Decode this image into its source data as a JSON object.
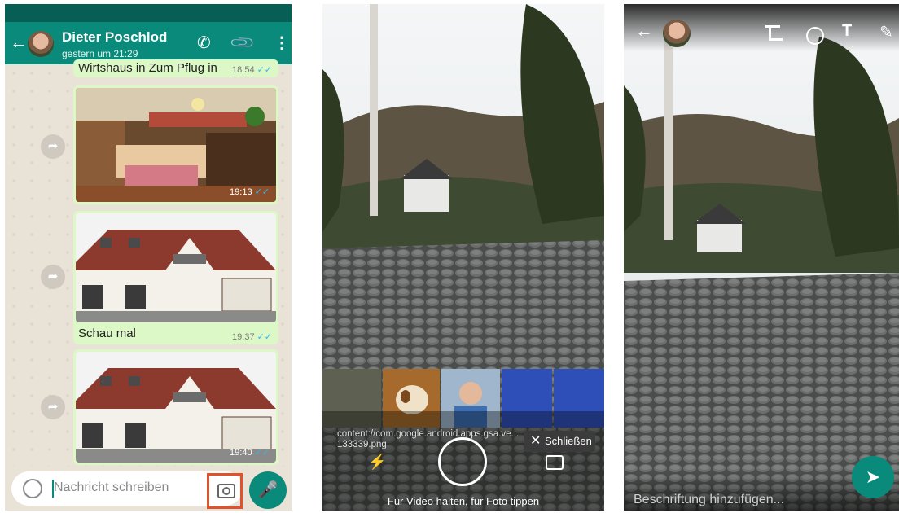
{
  "chat": {
    "contact_name": "Dieter Poschlod",
    "last_seen": "gestern um 21:29",
    "messages": [
      {
        "caption": "Wirtshaus in Zum Pflug in",
        "time": "18:54"
      },
      {
        "time": "19:13"
      },
      {
        "caption": "Schau mal",
        "time": "19:37"
      },
      {
        "time": "19:40"
      }
    ],
    "input_placeholder": "Nachricht schreiben",
    "icons": {
      "back": "arrow-left-icon",
      "call": "phone-icon",
      "attach": "paperclip-icon",
      "menu": "more-vert-icon",
      "emoji": "emoji-icon",
      "camera": "camera-icon",
      "mic": "mic-icon",
      "forward": "forward-icon"
    },
    "colors": {
      "header": "#0a8a7a",
      "bubble": "#dcf8c6",
      "highlight": "#e2502c"
    }
  },
  "camera": {
    "content_path": "content://com.google.android.apps.gsa.ve... 133339.png",
    "close_label": "Schließen",
    "hint": "Für Video halten, für Foto tippen",
    "icons": {
      "flash": "flash-icon",
      "shutter": "shutter-icon",
      "switch": "switch-camera-icon",
      "close": "close-icon"
    }
  },
  "editor": {
    "caption_placeholder": "Beschriftung hinzufügen...",
    "text_tool": "T",
    "icons": {
      "back": "arrow-left-icon",
      "crop": "crop-icon",
      "emoji": "emoji-icon",
      "text": "text-icon",
      "draw": "pencil-icon",
      "send": "send-icon"
    }
  }
}
